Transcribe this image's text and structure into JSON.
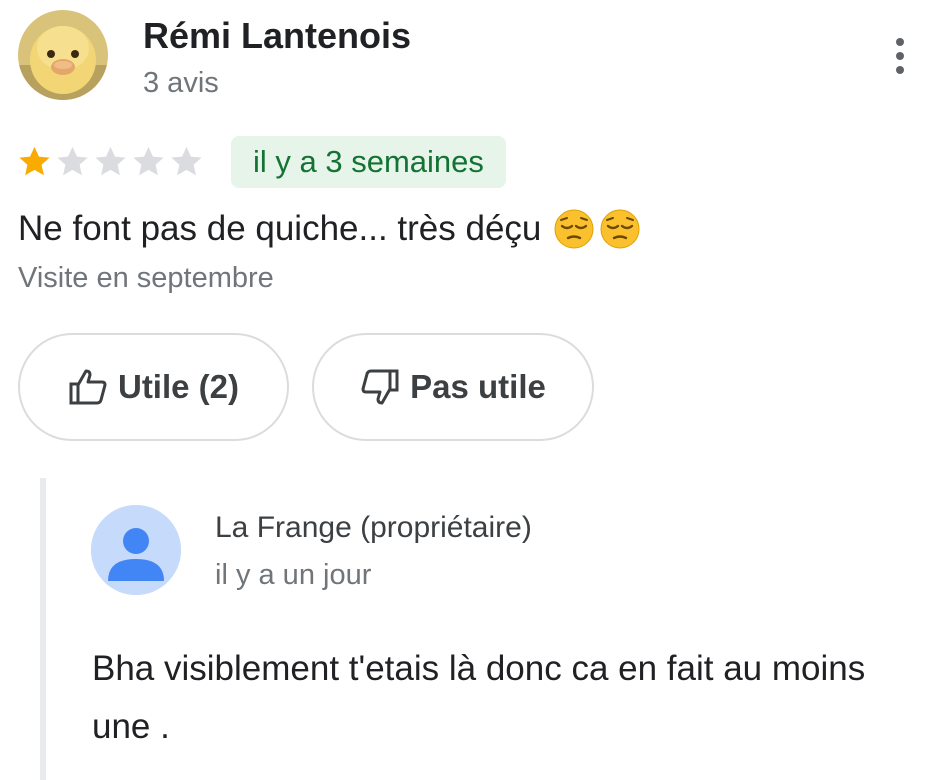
{
  "review": {
    "author_name": "Rémi Lantenois",
    "author_meta": "3 avis",
    "rating": 1,
    "max_rating": 5,
    "date": "il y a 3 semaines",
    "text": "Ne font pas de quiche... très déçu",
    "emoji_icons": [
      "pensive-face-icon",
      "pensive-face-icon"
    ],
    "visit": "Visite en septembre"
  },
  "actions": {
    "useful_label": "Utile (2)",
    "not_useful_label": "Pas utile"
  },
  "owner_reply": {
    "name": "La Frange (propriétaire)",
    "date": "il y a un jour",
    "text": "Bha visiblement t'etais là donc ca en fait au moins une ."
  },
  "colors": {
    "star_filled": "#f9ab00",
    "star_empty": "#dadce0",
    "badge_bg": "#e6f4ea",
    "badge_text": "#137333",
    "owner_avatar_bg": "#c6dafc",
    "owner_avatar_fg": "#4285f4"
  }
}
